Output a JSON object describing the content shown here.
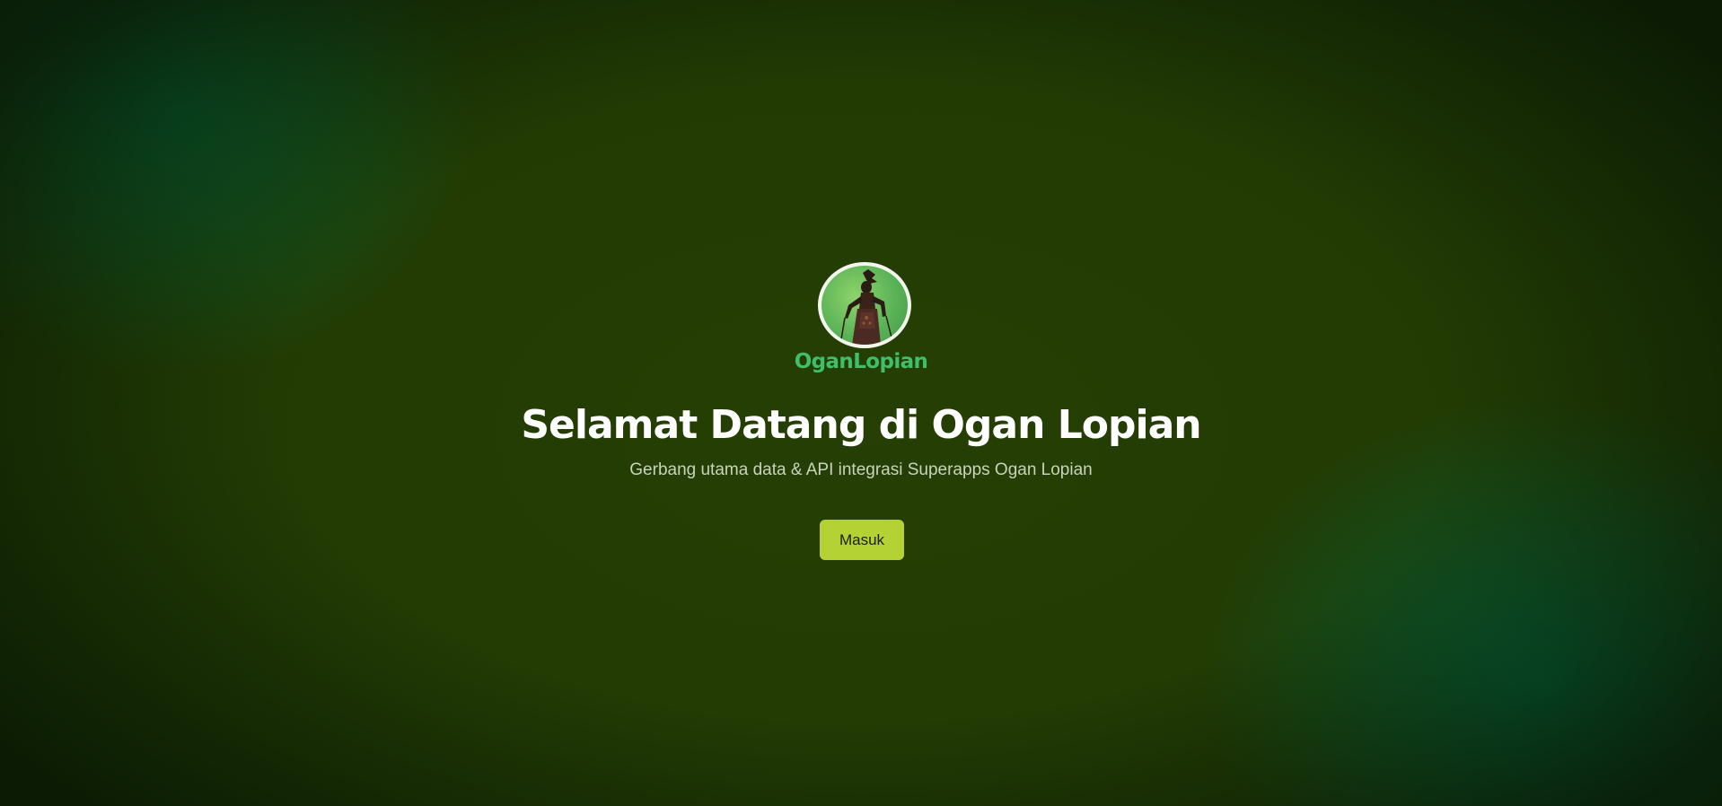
{
  "brand": {
    "name": "OganLopian",
    "logo_icon": "wayang-puppet-icon",
    "logo_color": "#3fbf6a"
  },
  "hero": {
    "title": "Selamat Datang di Ogan Lopian",
    "subtitle": "Gerbang utama data & API integrasi Superapps Ogan Lopian",
    "cta_label": "Masuk"
  },
  "colors": {
    "background": "#213a03",
    "accent_glow": "#086030",
    "button": "#b4d234",
    "button_text": "#1a1f10",
    "title": "#ffffff",
    "subtitle": "#c9d3bd"
  }
}
